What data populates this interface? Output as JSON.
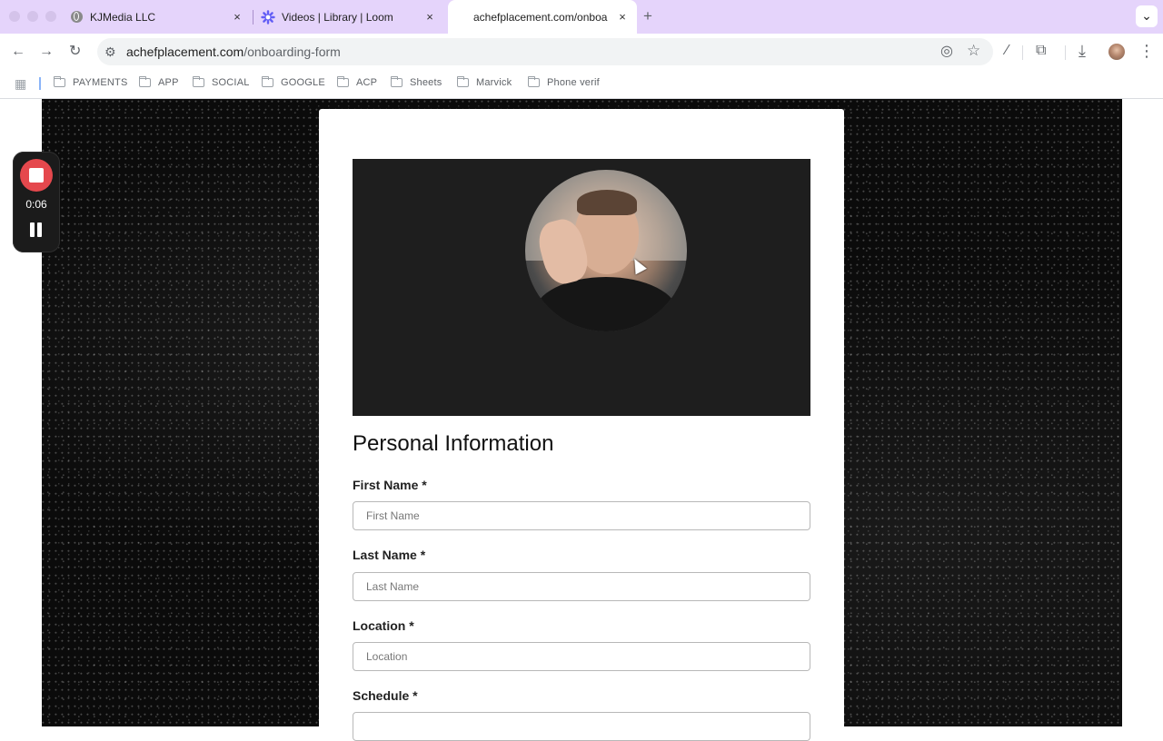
{
  "browser": {
    "tabs": [
      {
        "title": "KJMedia LLC",
        "close": "×"
      },
      {
        "title": "Videos | Library | Loom",
        "close": "×"
      },
      {
        "title": "achefplacement.com/onboard",
        "close": "×"
      }
    ],
    "new_tab": "+",
    "tab_menu": "⌄",
    "url_domain": "achefplacement.com",
    "url_path": "/onboarding-form",
    "bookmarks": [
      "PAYMENTS",
      "APP",
      "SOCIAL",
      "GOOGLE",
      "ACP",
      "Sheets",
      "Marvick",
      "Phone verif"
    ],
    "icons": {
      "back": "←",
      "forward": "→",
      "reload": "↻",
      "site_info": "⚙",
      "eye_off": "◎",
      "star": "☆",
      "pen": "⁄",
      "extensions": "⧉",
      "download": "⤓",
      "menu": "⋮",
      "apps": "▦"
    }
  },
  "recorder": {
    "time": "0:06",
    "accent": "#e5484d"
  },
  "form": {
    "section_title": "Personal Information",
    "fields": [
      {
        "label": "First Name *",
        "placeholder": "First Name"
      },
      {
        "label": "Last Name *",
        "placeholder": "Last Name"
      },
      {
        "label": "Location *",
        "placeholder": "Location"
      },
      {
        "label": "Schedule *",
        "placeholder": ""
      }
    ]
  }
}
